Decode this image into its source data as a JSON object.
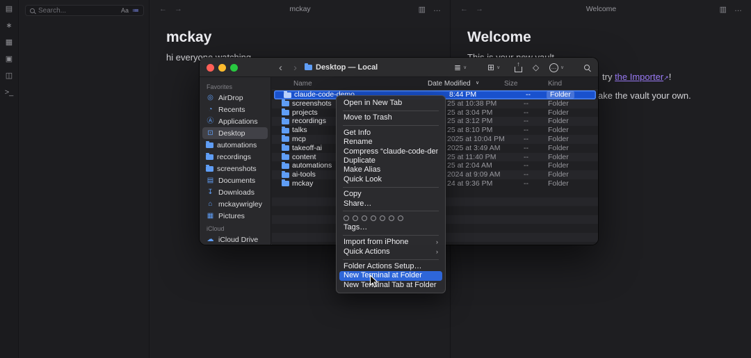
{
  "colors": {
    "close": "#ff5f57",
    "minimize": "#febc2e",
    "zoom": "#28c840",
    "accent": "#2e66d9",
    "selection": "#1951cd",
    "folder-blue": "#5f9df5",
    "link": "#9b7bf7"
  },
  "obsidian": {
    "ribbon_icons": [
      {
        "name": "files-icon",
        "glyph": "▤"
      },
      {
        "name": "graph-view-icon",
        "glyph": "∗"
      },
      {
        "name": "canvas-icon",
        "glyph": "▦"
      },
      {
        "name": "daily-note-icon",
        "glyph": "▣"
      },
      {
        "name": "templates-icon",
        "glyph": "◫"
      },
      {
        "name": "terminal-icon",
        "glyph": ">_"
      }
    ],
    "search": {
      "placeholder": "Search...",
      "match_case": "Aa",
      "filter_glyph": "≔"
    },
    "nav": {
      "back": "←",
      "forward": "→",
      "reading_glyph": "▥",
      "more": "…"
    },
    "panes": [
      {
        "tab_title": "mckay",
        "heading": "mckay",
        "body": "hi everyone watching"
      },
      {
        "tab_title": "Welcome",
        "heading": "Welcome",
        "line1": "This is your new vault",
        "line2_prefix": "try ",
        "line2_link": "the Importer",
        "line2_ext": "↗",
        "line2_suffix": "!",
        "line3": "ake the vault your own."
      }
    ]
  },
  "finder": {
    "window_title": "Desktop — Local",
    "toolbar": {
      "back": "‹",
      "forward": "›",
      "view_glyph": "≣",
      "group_glyph": "⊞",
      "tag_glyph": "◇",
      "more_glyph": "…",
      "chevron": "∨"
    },
    "sidebar_items": [
      {
        "type": "section",
        "label": "Favorites"
      },
      {
        "label": "AirDrop",
        "icon": "airdrop",
        "glyph": "◎"
      },
      {
        "label": "Recents",
        "icon": "recents",
        "glyph": "◔"
      },
      {
        "label": "Applications",
        "icon": "applications",
        "glyph": "Ⓐ"
      },
      {
        "label": "Desktop",
        "icon": "desktop",
        "glyph": "⊡",
        "selected": true
      },
      {
        "label": "automations",
        "icon": "folder"
      },
      {
        "label": "recordings",
        "icon": "folder"
      },
      {
        "label": "screenshots",
        "icon": "folder"
      },
      {
        "label": "Documents",
        "icon": "documents",
        "glyph": "▤"
      },
      {
        "label": "Downloads",
        "icon": "downloads",
        "glyph": "↧"
      },
      {
        "label": "mckaywrigley",
        "icon": "home",
        "glyph": "⌂"
      },
      {
        "label": "Pictures",
        "icon": "pictures",
        "glyph": "▦"
      },
      {
        "type": "section",
        "label": "iCloud"
      },
      {
        "label": "iCloud Drive",
        "icon": "icloud",
        "glyph": "☁"
      }
    ],
    "columns": {
      "name": "Name",
      "date": "Date Modified",
      "size": "Size",
      "kind": "Kind",
      "sort_indicator": "∨"
    },
    "rows": [
      {
        "name": "claude-code-demo",
        "date": "8:44 PM",
        "size": "--",
        "kind": "Folder",
        "selected": true
      },
      {
        "name": "screenshots",
        "date": "25 at 10:38 PM",
        "size": "--",
        "kind": "Folder"
      },
      {
        "name": "projects",
        "date": "25 at 3:04 PM",
        "size": "--",
        "kind": "Folder"
      },
      {
        "name": "recordings",
        "date": "25 at 3:12 PM",
        "size": "--",
        "kind": "Folder"
      },
      {
        "name": "talks",
        "date": "25 at 8:10 PM",
        "size": "--",
        "kind": "Folder"
      },
      {
        "name": "mcp",
        "date": "2025 at 10:04 PM",
        "size": "--",
        "kind": "Folder"
      },
      {
        "name": "takeoff-ai",
        "date": "2025 at 3:49 AM",
        "size": "--",
        "kind": "Folder"
      },
      {
        "name": "content",
        "date": "25 at 11:40 PM",
        "size": "--",
        "kind": "Folder"
      },
      {
        "name": "automations",
        "date": "25 at 2:04 AM",
        "size": "--",
        "kind": "Folder"
      },
      {
        "name": "ai-tools",
        "date": "2024 at 9:09 AM",
        "size": "--",
        "kind": "Folder"
      },
      {
        "name": "mckay",
        "date": "24 at 9:36 PM",
        "size": "--",
        "kind": "Folder"
      }
    ]
  },
  "context_menu": {
    "submenu_glyph": "›",
    "items": [
      {
        "label": "Open in New Tab"
      },
      {
        "type": "separator"
      },
      {
        "label": "Move to Trash"
      },
      {
        "type": "separator"
      },
      {
        "label": "Get Info"
      },
      {
        "label": "Rename"
      },
      {
        "label": "Compress “claude-code-demo”"
      },
      {
        "label": "Duplicate"
      },
      {
        "label": "Make Alias"
      },
      {
        "label": "Quick Look"
      },
      {
        "type": "separator"
      },
      {
        "label": "Copy"
      },
      {
        "label": "Share…"
      },
      {
        "type": "separator"
      },
      {
        "type": "tags",
        "dots": [
          "#97979c",
          "#97979c",
          "#97979c",
          "#97979c",
          "#97979c",
          "#97979c",
          "#97979c"
        ]
      },
      {
        "label": "Tags…"
      },
      {
        "type": "separator"
      },
      {
        "label": "Import from iPhone",
        "submenu": true
      },
      {
        "label": "Quick Actions",
        "submenu": true
      },
      {
        "type": "separator"
      },
      {
        "label": "Folder Actions Setup…"
      },
      {
        "label": "New Terminal at Folder",
        "highlighted": true
      },
      {
        "label": "New Terminal Tab at Folder"
      }
    ]
  }
}
